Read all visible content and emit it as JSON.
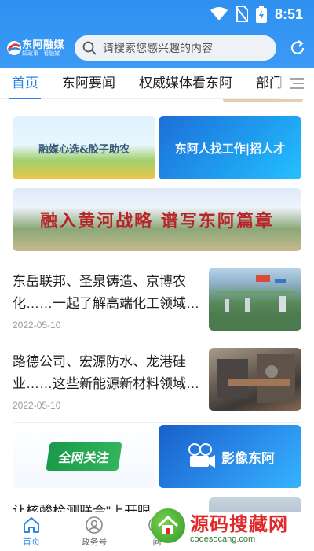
{
  "status_bar": {
    "time": "8:51"
  },
  "app": {
    "logo_main": "东阿融媒",
    "logo_sub": "知政事 · 看融媒",
    "search_placeholder": "请搜索您感兴趣的内容"
  },
  "tabs": [
    {
      "label": "首页",
      "active": true
    },
    {
      "label": "东阿要闻",
      "active": false
    },
    {
      "label": "权威媒体看东阿",
      "active": false
    },
    {
      "label": "部门",
      "active": false
    }
  ],
  "banners": {
    "b1": "融媒心选&胶子助农",
    "b2": "东阿人找工作|招人才",
    "b3": "融入黄河战略  谱写东阿篇章",
    "b4": "全网关注",
    "b5": "影像东阿"
  },
  "articles": [
    {
      "title": "东岳联邦、圣泉铸造、京博农化……一起了解高端化工领域…",
      "date": "2022-05-10"
    },
    {
      "title": "路德公司、宏源防水、龙港硅业……这些新能源新材料领域…",
      "date": "2022-05-10"
    },
    {
      "title": "让核酸检测联合\"上开眼",
      "date": ""
    }
  ],
  "bottom_nav": [
    {
      "label": "首页",
      "icon": "home-icon",
      "active": true
    },
    {
      "label": "政务号",
      "icon": "user-icon",
      "active": false
    },
    {
      "label": "问",
      "icon": "question-icon",
      "active": false
    }
  ],
  "watermark": {
    "main": "源码搜藏网",
    "sub": "codesocang.com"
  },
  "colors": {
    "accent": "#2a86e6",
    "header": "#3b9af5"
  }
}
